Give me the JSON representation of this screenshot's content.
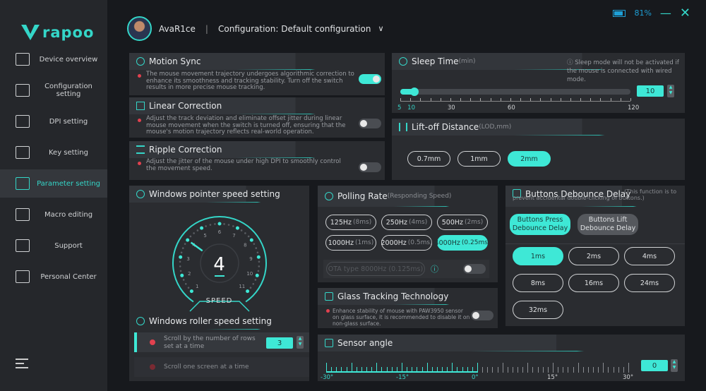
{
  "brand": {
    "name": "rapoo",
    "accent": "#3ee8d6"
  },
  "window": {
    "battery_percent": "81%",
    "battery_level": 0.81
  },
  "sidebar": {
    "items": [
      {
        "label": "Device overview",
        "icon": "monitor-chart-icon"
      },
      {
        "label": "Configuration setting",
        "icon": "config-gear-icon"
      },
      {
        "label": "DPI setting",
        "icon": "dpi-icon"
      },
      {
        "label": "Key setting",
        "icon": "mouse-icon"
      },
      {
        "label": "Parameter setting",
        "icon": "sliders-icon",
        "active": true
      },
      {
        "label": "Macro editing",
        "icon": "macro-icon"
      },
      {
        "label": "Support",
        "icon": "thumbs-up-icon"
      },
      {
        "label": "Personal Center",
        "icon": "user-icon"
      }
    ]
  },
  "header": {
    "username": "AvaR1ce",
    "separator": "|",
    "configuration": "Configuration: Default configuration"
  },
  "motion_sync": {
    "title": "Motion Sync",
    "desc": "The mouse movement trajectory undergoes algorithmic correction to enhance its smoothness and tracking stability. Turn off the switch results in more precise mouse tracking.",
    "enabled": true
  },
  "linear_correction": {
    "title": "Linear Correction",
    "desc": "Adjust the track deviation and eliminate offset jitter during linear mouse movement when the switch is turned off, ensuring that the mouse's motion trajectory reflects real-world operation.",
    "enabled": false
  },
  "ripple_correction": {
    "title": "Ripple Correction",
    "desc": "Adjust the jitter of the mouse under high DPI to smoothly control the movement speed.",
    "enabled": false
  },
  "sleep_time": {
    "title": "Sleep Time",
    "unit": "(min)",
    "note": "Sleep mode will not be activated if the mouse is connected with wired mode.",
    "value": "10",
    "min": 5,
    "max": 120,
    "ticks": [
      "5",
      "10",
      "30",
      "60",
      "120"
    ]
  },
  "lod": {
    "title": "Lift-off Distance",
    "unit": "(LOD,mm)",
    "options": [
      "0.7mm",
      "1mm",
      "2mm"
    ],
    "selected": 2
  },
  "pointer_speed": {
    "title": "Windows pointer speed setting",
    "value": "4",
    "label": "SPEED",
    "scale": [
      "1",
      "2",
      "3",
      "4",
      "5",
      "6",
      "7",
      "8",
      "9",
      "10",
      "11"
    ]
  },
  "roller": {
    "title": "Windows roller speed setting",
    "option_rows": "Scroll by the number of rows set at a time",
    "rows_value": "3",
    "option_screen": "Scroll one screen at a time"
  },
  "polling": {
    "title": "Polling Rate",
    "subtitle": "(Responding Speed)",
    "options": [
      {
        "hz": "125Hz",
        "ms": "(8ms)"
      },
      {
        "hz": "250Hz",
        "ms": "(4ms)"
      },
      {
        "hz": "500Hz",
        "ms": "(2ms)"
      },
      {
        "hz": "1000Hz",
        "ms": "(1ms)"
      },
      {
        "hz": "2000Hz",
        "ms": "(0.5ms)"
      },
      {
        "hz": "4000Hz",
        "ms": "(0.25ms)"
      }
    ],
    "selected": 5,
    "ota": "OTA type 8000Hz (0.125ms)",
    "ota_enabled": false
  },
  "glass": {
    "title": "Glass Tracking Technology",
    "desc": "Enhance stability of mouse with PAW3950 sensor on glass surface, it is recommended to disable it on non-glass surface.",
    "enabled": false
  },
  "debounce": {
    "title": "Buttons Debounce Delay",
    "note": "(This function is to prevent accidental double-clicking of buttons.)",
    "press": "Buttons Press Debounce Delay",
    "lift": "Buttons Lift Debounce Delay",
    "options": [
      "1ms",
      "2ms",
      "4ms",
      "8ms",
      "16ms",
      "24ms",
      "32ms"
    ],
    "selected": 0
  },
  "sensor_angle": {
    "title": "Sensor angle",
    "value": "0",
    "min": -30,
    "max": 30,
    "ticks": [
      "-30°",
      "-15°",
      "0°",
      "15°",
      "30°"
    ]
  }
}
